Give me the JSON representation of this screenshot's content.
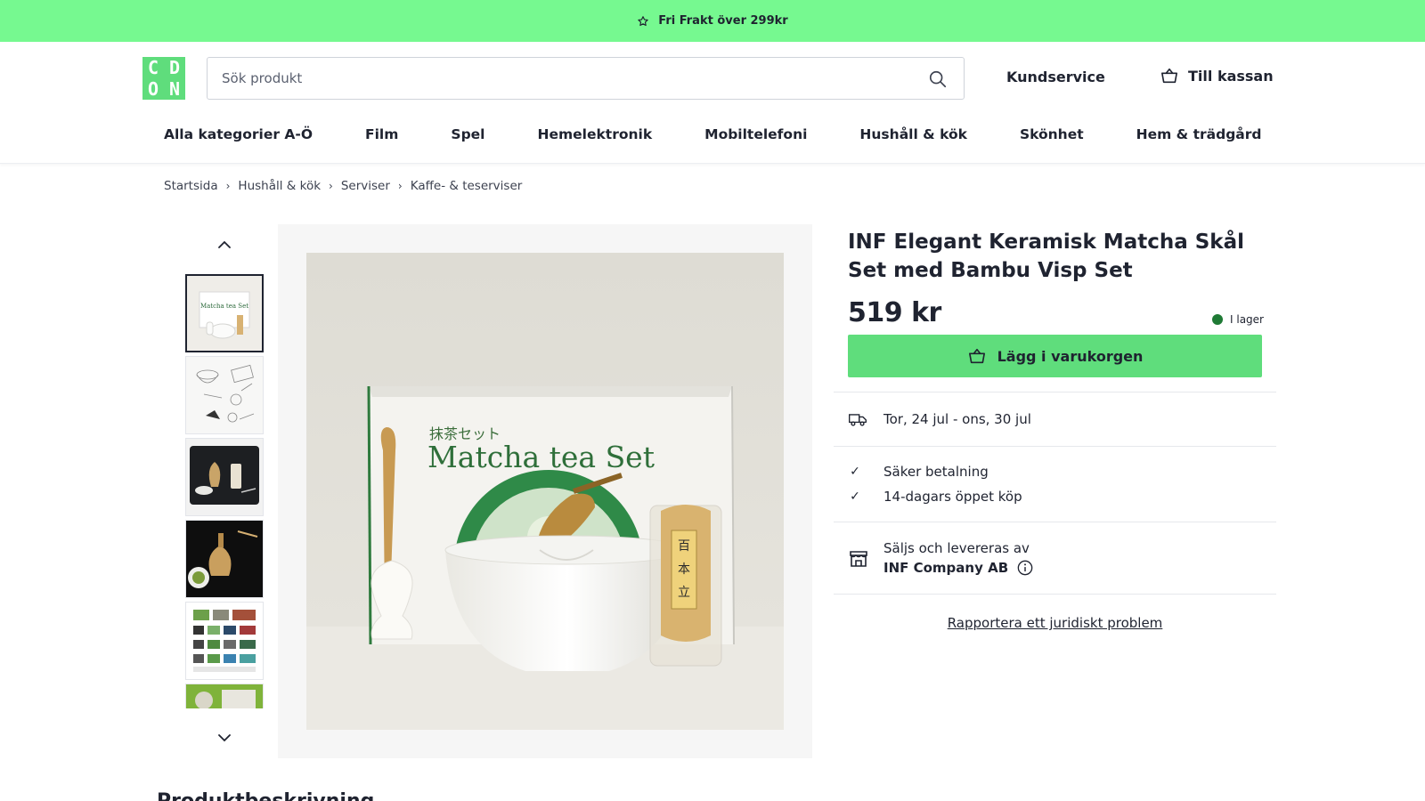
{
  "promo": {
    "text": "Fri Frakt över 299kr",
    "icon": "star-icon"
  },
  "header": {
    "logo_letters": [
      "C",
      "D",
      "O",
      "N"
    ],
    "search": {
      "placeholder": "Sök produkt",
      "value": ""
    },
    "customer_service": "Kundservice",
    "checkout": "Till kassan"
  },
  "nav": [
    "Alla kategorier A-Ö",
    "Film",
    "Spel",
    "Hemelektronik",
    "Mobiltelefoni",
    "Hushåll & kök",
    "Skönhet",
    "Hem & trädgård"
  ],
  "breadcrumb": [
    "Startsida",
    "Hushåll & kök",
    "Serviser",
    "Kaffe- & teserviser"
  ],
  "gallery": {
    "image_text": {
      "japanese": "抹茶セット",
      "english": "Matcha tea Set",
      "whisk_label": [
        "百",
        "本",
        "立"
      ]
    },
    "thumb_text": "Matcha tea Set",
    "thumbnail_count": 6,
    "selected_index": 0
  },
  "product": {
    "title": "INF Elegant Keramisk Matcha Skål Set med Bambu Visp Set",
    "price": "519 kr",
    "stock": "I lager",
    "add_to_cart": "Lägg i varukorgen",
    "delivery": "Tor, 24 jul - ons, 30 jul",
    "usps": [
      "Säker betalning",
      "14-dagars öppet köp"
    ],
    "seller_label": "Säljs och levereras av",
    "seller_name": "INF Company AB",
    "report_link": "Rapportera ett juridiskt problem"
  },
  "colors": {
    "brand_green": "#5fdd7c",
    "promo_green": "#76f990",
    "text": "#1f2330",
    "in_stock": "#1f7a35"
  },
  "section_title": "Produktbeskrivning"
}
